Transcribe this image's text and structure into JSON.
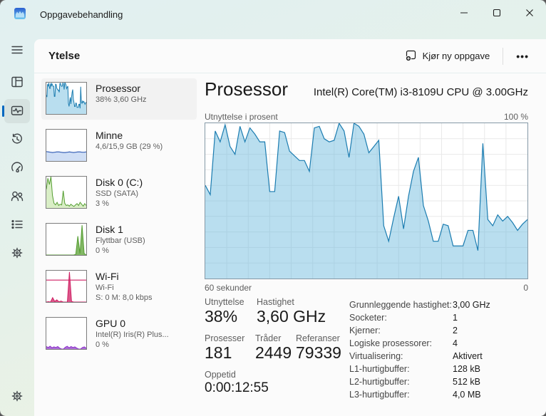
{
  "window": {
    "title": "Oppgavebehandling",
    "controls": {
      "minimize": "minimize",
      "maximize": "maximize",
      "close": "close"
    }
  },
  "header": {
    "page_title": "Ytelse",
    "run_new_task": "Kjør ny oppgave",
    "more": "•••"
  },
  "sidebar": {
    "items": [
      {
        "name": "Prosessor",
        "line2": "38% 3,60 GHz",
        "line3": ""
      },
      {
        "name": "Minne",
        "line2": "4,6/15,9 GB (29 %)",
        "line3": ""
      },
      {
        "name": "Disk 0 (C:)",
        "line2": "SSD (SATA)",
        "line3": "3 %"
      },
      {
        "name": "Disk 1",
        "line2": "Flyttbar (USB)",
        "line3": "0 %"
      },
      {
        "name": "Wi-Fi",
        "line2": "Wi-Fi",
        "line3": "S: 0 M: 8,0 kbps"
      },
      {
        "name": "GPU 0",
        "line2": "Intel(R) Iris(R) Plus...",
        "line3": "0 %"
      }
    ]
  },
  "main": {
    "title": "Prosessor",
    "cpu_name": "Intel(R) Core(TM) i3-8109U CPU @ 3.00GHz",
    "chart_top_left": "Utnyttelse i prosent",
    "chart_top_right": "100 %",
    "chart_bottom_left": "60 sekunder",
    "chart_bottom_right": "0",
    "stats": {
      "utilization_label": "Utnyttelse",
      "utilization": "38%",
      "speed_label": "Hastighet",
      "speed": "3,60 GHz",
      "processes_label": "Prosesser",
      "processes": "181",
      "threads_label": "Tråder",
      "threads": "2449",
      "handles_label": "Referanser",
      "handles": "79339",
      "uptime_label": "Oppetid",
      "uptime": "0:00:12:55"
    },
    "info": [
      {
        "label": "Grunnleggende hastighet:",
        "value": "3,00 GHz"
      },
      {
        "label": "Socketer:",
        "value": "1"
      },
      {
        "label": "Kjerner:",
        "value": "2"
      },
      {
        "label": "Logiske prosessorer:",
        "value": "4"
      },
      {
        "label": "Virtualisering:",
        "value": "Aktivert"
      },
      {
        "label": "L1-hurtigbuffer:",
        "value": "128 kB"
      },
      {
        "label": "L2-hurtigbuffer:",
        "value": "512 kB"
      },
      {
        "label": "L3-hurtigbuffer:",
        "value": "4,0 MB"
      }
    ]
  },
  "colors": {
    "accent": "#0067c0",
    "cpu_line": "#1b7cb0",
    "cpu_fill": "rgba(99,181,220,0.45)",
    "memory_line": "#3a63b8",
    "disk_line": "#559e32",
    "wifi_line": "#cf1f63",
    "gpu_line": "#8b31c9"
  },
  "chart_data": {
    "type": "area",
    "title": "Utnyttelse i prosent",
    "xlabel": "60 sekunder → 0",
    "ylabel": "% CPU-utnyttelse",
    "ylim": [
      0,
      100
    ],
    "x_window_seconds": 60,
    "values": [
      60,
      54,
      95,
      88,
      99,
      85,
      80,
      98,
      88,
      97,
      93,
      88,
      88,
      56,
      56,
      95,
      94,
      82,
      79,
      76,
      76,
      69,
      97,
      98,
      90,
      88,
      89,
      100,
      95,
      78,
      100,
      98,
      93,
      81,
      85,
      89,
      34,
      24,
      39,
      53,
      32,
      53,
      69,
      78,
      47,
      37,
      24,
      24,
      35,
      34,
      21,
      21,
      21,
      31,
      31,
      18,
      87,
      38,
      34,
      41,
      37,
      40,
      36,
      31,
      35,
      38
    ]
  },
  "charts": {
    "cpu_main": {
      "values": [
        60,
        54,
        95,
        88,
        99,
        85,
        80,
        98,
        88,
        97,
        93,
        88,
        88,
        56,
        56,
        95,
        94,
        82,
        79,
        76,
        76,
        69,
        97,
        98,
        90,
        88,
        89,
        100,
        95,
        78,
        100,
        98,
        93,
        81,
        85,
        89,
        34,
        24,
        39,
        53,
        32,
        53,
        69,
        78,
        47,
        37,
        24,
        24,
        35,
        34,
        21,
        21,
        21,
        31,
        31,
        18,
        87,
        38,
        34,
        41,
        37,
        40,
        36,
        31,
        35,
        38
      ],
      "max": 100,
      "line": "#1b7cb0",
      "lw": 1.2,
      "fill": "rgba(99,181,220,0.45)",
      "grid": {
        "cols": 15,
        "rows": 10,
        "color": "#e9e9e9"
      }
    },
    "cpu_thumb": {
      "values": [
        60,
        54,
        95,
        88,
        99,
        85,
        80,
        98,
        88,
        97,
        93,
        88,
        88,
        56,
        56,
        95,
        94,
        82,
        79,
        76,
        76,
        69,
        97,
        98,
        90,
        88,
        89,
        100,
        95,
        78,
        100,
        98,
        93,
        81,
        85,
        89,
        34,
        24,
        39,
        53,
        32,
        53,
        69,
        78,
        47,
        37,
        24,
        24,
        35,
        34,
        21,
        21,
        21,
        31,
        31,
        18,
        87,
        38,
        34,
        41,
        37,
        40,
        36,
        31,
        35,
        38
      ],
      "max": 100,
      "line": "#1b7cb0",
      "lw": 1,
      "fill": "rgba(99,181,220,0.45)"
    },
    "memory_thumb": {
      "values": [
        30,
        29,
        28,
        27,
        28,
        29,
        29,
        28,
        27,
        27,
        28,
        29,
        28,
        27,
        28,
        29,
        29,
        28,
        28,
        29
      ],
      "max": 100,
      "line": "#3a63b8",
      "lw": 1.2,
      "fill": "#cfdef5"
    },
    "disk0_thumb": {
      "values": [
        60,
        95,
        75,
        100,
        40,
        15,
        10,
        18,
        8,
        12,
        10,
        55,
        15,
        8,
        10,
        6,
        12,
        8,
        5,
        10,
        14,
        8,
        18,
        12,
        6,
        14,
        8
      ],
      "max": 100,
      "line": "#559e32",
      "lw": 1,
      "fill": "#d9eec6"
    },
    "disk1_thumb": {
      "values": [
        0,
        0,
        0,
        0,
        0,
        0,
        0,
        0,
        0,
        0,
        0,
        0,
        0,
        0,
        2,
        60,
        5,
        95,
        5,
        0
      ],
      "max": 100,
      "line": "#559e32",
      "lw": 1,
      "fill": "rgba(90,160,50,0.75)"
    },
    "wifi_thumb": {
      "values": [
        0,
        1,
        0,
        14,
        2,
        7,
        1,
        3,
        0,
        0,
        0,
        96,
        2,
        0,
        0,
        0,
        0,
        0,
        0,
        0
      ],
      "max": 100,
      "line": "#cf1f63",
      "lw": 1,
      "fill": "rgba(207,31,99,0.75)",
      "hline": 70
    },
    "gpu_thumb": {
      "values": [
        8,
        5,
        9,
        4,
        7,
        5,
        8,
        3,
        0,
        0,
        6,
        9,
        4,
        8,
        5,
        7,
        3,
        0,
        0,
        5,
        7,
        3
      ],
      "max": 100,
      "line": "#8b31c9",
      "lw": 1,
      "fill": "rgba(139,49,201,0.7)"
    }
  }
}
